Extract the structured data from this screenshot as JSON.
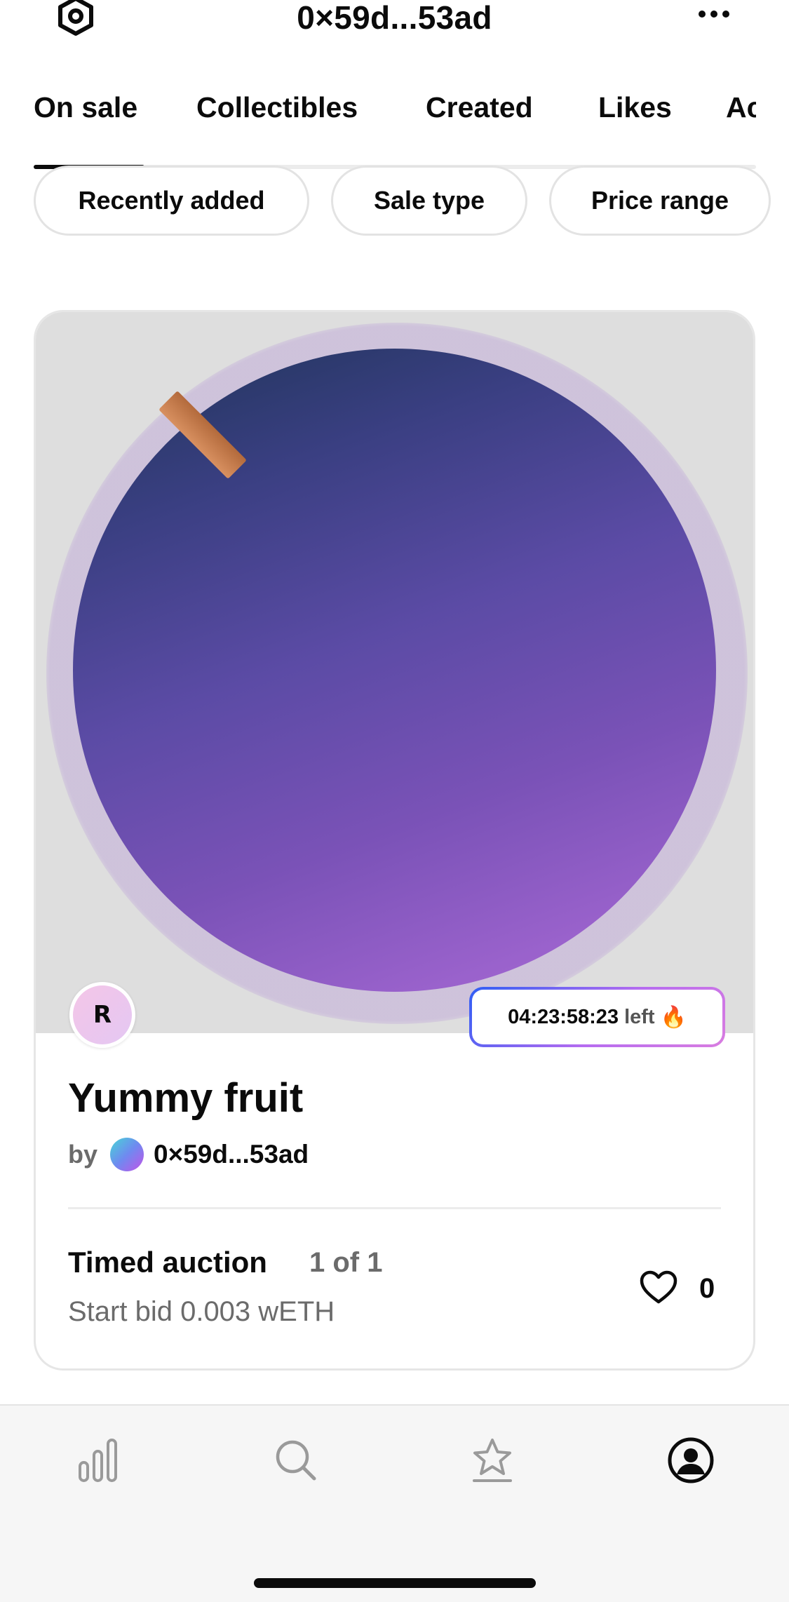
{
  "header": {
    "title": "0×59d...53ad",
    "settings_icon": "settings-icon",
    "more_icon": "more-dots-icon"
  },
  "tabs": [
    {
      "label": "On sale",
      "active": true
    },
    {
      "label": "Collectibles",
      "active": false
    },
    {
      "label": "Created",
      "active": false
    },
    {
      "label": "Likes",
      "active": false
    },
    {
      "label": "Ac",
      "active": false
    }
  ],
  "filters": [
    {
      "label": "Recently added"
    },
    {
      "label": "Sale type"
    },
    {
      "label": "Price range"
    }
  ],
  "card": {
    "creator_initial": "R",
    "timer": "04:23:58:23",
    "timer_suffix": "left",
    "timer_icon": "🔥",
    "title": "Yummy fruit",
    "by_label": "by",
    "owner": "0×59d...53ad",
    "sale_type": "Timed auction",
    "edition": "1 of 1",
    "start_bid": "Start bid 0.003 wETH",
    "likes": "0"
  },
  "bottom_nav": [
    {
      "icon": "stats-icon",
      "active": false
    },
    {
      "icon": "search-icon",
      "active": false
    },
    {
      "icon": "star-icon",
      "active": false
    },
    {
      "icon": "profile-icon",
      "active": true
    }
  ],
  "colors": {
    "accent_timer_start": "#2f5ef4",
    "accent_timer_end": "#d97de0",
    "text_primary": "#0b0b0b",
    "text_secondary": "#6b6b6b"
  }
}
